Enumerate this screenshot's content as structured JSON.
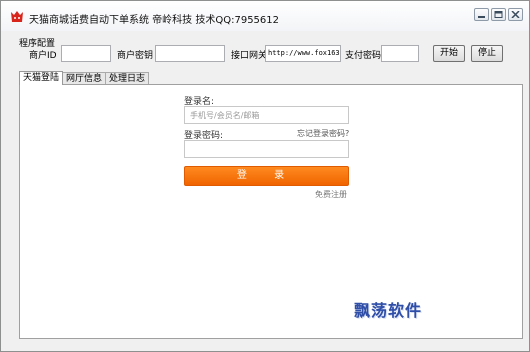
{
  "window": {
    "title": "天猫商城话费自动下单系统 帝岭科技 技术QQ:7955612"
  },
  "config": {
    "group_title": "程序配置",
    "merchant_id_label": "商户ID",
    "merchant_id_value": "",
    "merchant_key_label": "商户密钥",
    "merchant_key_value": "",
    "gateway_label": "接口网关",
    "gateway_value": "http://www.fox163.",
    "pay_password_label": "支付密码",
    "pay_password_value": "",
    "start_label": "开始",
    "stop_label": "停止"
  },
  "tabs": [
    "天猫登陆",
    "网厅信息",
    "处理日志"
  ],
  "login": {
    "username_label": "登录名:",
    "username_placeholder": "手机号/会员名/邮箱",
    "password_label": "登录密码:",
    "forgot_link": "忘记登录密码?",
    "login_button": "登 录",
    "register_link": "免费注册"
  },
  "watermark": "飘荡软件",
  "colors": {
    "accent": "#f57000",
    "watermark": "#2f4ea8"
  },
  "icons": [
    "app-logo-icon",
    "minimize-icon",
    "maximize-icon",
    "close-icon"
  ]
}
